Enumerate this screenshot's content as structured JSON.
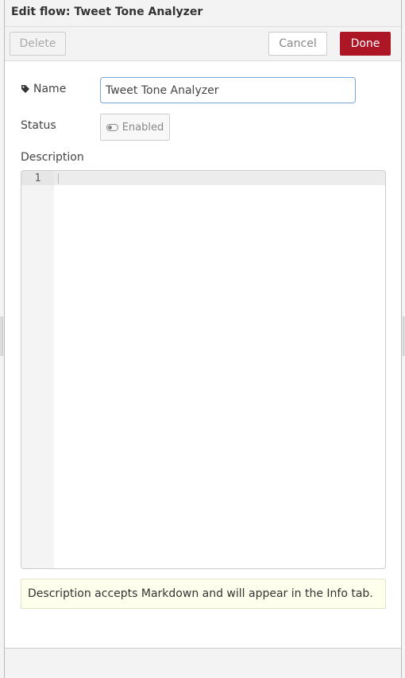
{
  "window": {
    "title": "Edit flow: Tweet Tone Analyzer"
  },
  "toolbar": {
    "delete_label": "Delete",
    "cancel_label": "Cancel",
    "done_label": "Done",
    "accent": "#ad1625"
  },
  "form": {
    "name_label": "Name",
    "name_icon": "tag-icon",
    "name_value": "Tweet Tone Analyzer",
    "status_label": "Status",
    "status_value": "Enabled",
    "status_icon": "toggle-icon",
    "description_label": "Description"
  },
  "editor": {
    "line_numbers": [
      "1"
    ],
    "content": ""
  },
  "help": {
    "text": "Description accepts Markdown and will appear in the Info tab."
  }
}
